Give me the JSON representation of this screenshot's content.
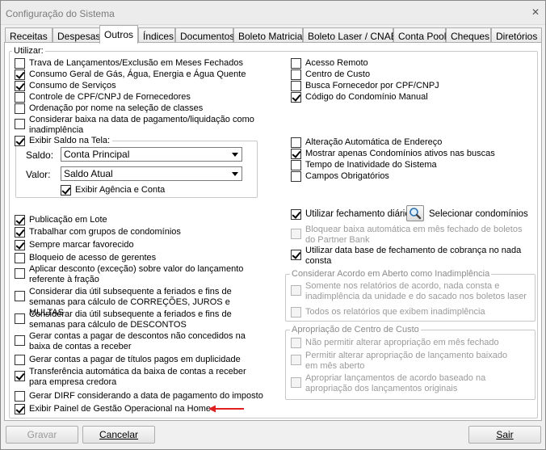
{
  "window": {
    "title": "Configuração do Sistema",
    "close_glyph": "✕"
  },
  "tabs": [
    {
      "label": "Receitas"
    },
    {
      "label": "Despesas"
    },
    {
      "label": "Outros"
    },
    {
      "label": "Índices"
    },
    {
      "label": "Documentos"
    },
    {
      "label": "Boleto Matricial"
    },
    {
      "label": "Boleto Laser / CNAB"
    },
    {
      "label": "Conta Pool"
    },
    {
      "label": "Cheques"
    },
    {
      "label": "Diretórios"
    }
  ],
  "active_tab": "Outros",
  "group_label": "Utilizar:",
  "left_top": [
    {
      "label": "Trava de Lançamentos/Exclusão em Meses Fechados",
      "checked": false
    },
    {
      "label": "Consumo Geral de Gás, Água, Energia e Água Quente",
      "checked": true
    },
    {
      "label": "Consumo de Serviços",
      "checked": true
    },
    {
      "label": "Controle de CPF/CNPJ de Fornecedores",
      "checked": false
    },
    {
      "label": "Ordenação por nome na seleção de classes",
      "checked": false
    },
    {
      "label": "Considerar baixa na data de pagamento/liquidação como inadimplência",
      "checked": false
    }
  ],
  "saldo_box": {
    "title": "Exibir Saldo na Tela:",
    "checked": true,
    "saldo_label": "Saldo:",
    "saldo_value": "Conta Principal",
    "valor_label": "Valor:",
    "valor_value": "Saldo Atual",
    "agencia_label": "Exibir Agência e Conta",
    "agencia_checked": true
  },
  "left_bottom": [
    {
      "label": "Publicação em Lote",
      "checked": true
    },
    {
      "label": "Trabalhar com grupos de condomínios",
      "checked": true
    },
    {
      "label": "Sempre marcar favorecido",
      "checked": true
    },
    {
      "label": "Bloqueio de acesso de gerentes",
      "checked": false
    },
    {
      "label": "Aplicar desconto (exceção) sobre valor do lançamento referente à fração",
      "checked": false
    },
    {
      "label": "Considerar dia útil subsequente a feriados e fins de semanas para cálculo de CORREÇÕES, JUROS e MULTAS",
      "checked": false
    },
    {
      "label": "Considerar dia útil subsequente a feriados e fins de semanas para cálculo de DESCONTOS",
      "checked": false
    },
    {
      "label": "Gerar contas a pagar de descontos não concedidos na baixa de contas a receber",
      "checked": false
    },
    {
      "label": "Gerar contas a pagar de títulos pagos em duplicidade",
      "checked": false
    },
    {
      "label": "Transferência automática da baixa de contas a receber para empresa credora",
      "checked": true
    },
    {
      "label": "Gerar DIRF considerando a data de pagamento do imposto",
      "checked": false
    },
    {
      "label": "Exibir Painel de Gestão Operacional na Home",
      "checked": true
    }
  ],
  "right_top": [
    {
      "label": "Acesso Remoto",
      "checked": false
    },
    {
      "label": "Centro de Custo",
      "checked": false
    },
    {
      "label": "Busca Fornecedor por CPF/CNPJ",
      "checked": false
    },
    {
      "label": "Código do Condomínio Manual",
      "checked": true
    }
  ],
  "right_mid": [
    {
      "label": "Alteração Automática de Endereço",
      "checked": false
    },
    {
      "label": "Mostrar apenas Condomínios ativos nas buscas",
      "checked": true
    },
    {
      "label": "Tempo de Inatividade do Sistema",
      "checked": false
    },
    {
      "label": "Campos Obrigatórios",
      "checked": false
    }
  ],
  "fechamento": {
    "label": "Utilizar fechamento diário",
    "checked": true,
    "select_label": "Selecionar condomínios"
  },
  "right_fech": [
    {
      "label": "Bloquear baixa automática em mês fechado de boletos do Partner Bank",
      "checked": false,
      "disabled": true
    },
    {
      "label": "Utilizar data base de fechamento de cobrança no nada consta",
      "checked": true,
      "disabled": false
    }
  ],
  "acordo": {
    "title": "Considerar Acordo em Aberto como Inadimplência",
    "items": [
      {
        "label": "Somente nos relatórios de acordo, nada consta e inadimplência da unidade e do sacado nos boletos laser",
        "checked": false
      },
      {
        "label": "Todos os relatórios que exibem inadimplência",
        "checked": false
      }
    ]
  },
  "apropriacao": {
    "title": "Apropriação de Centro de Custo",
    "items": [
      {
        "label": "Não permitir alterar apropriação em mês fechado",
        "checked": false
      },
      {
        "label": "Permitir alterar apropriação de lançamento baixado em mês aberto",
        "checked": false
      },
      {
        "label": "Apropriar lançamentos de acordo baseado na apropriação dos lançamentos originais",
        "checked": false
      }
    ]
  },
  "buttons": {
    "gravar": "Gravar",
    "cancelar": "Cancelar",
    "sair": "Sair"
  },
  "colors": {
    "arrow": "#e02020"
  }
}
